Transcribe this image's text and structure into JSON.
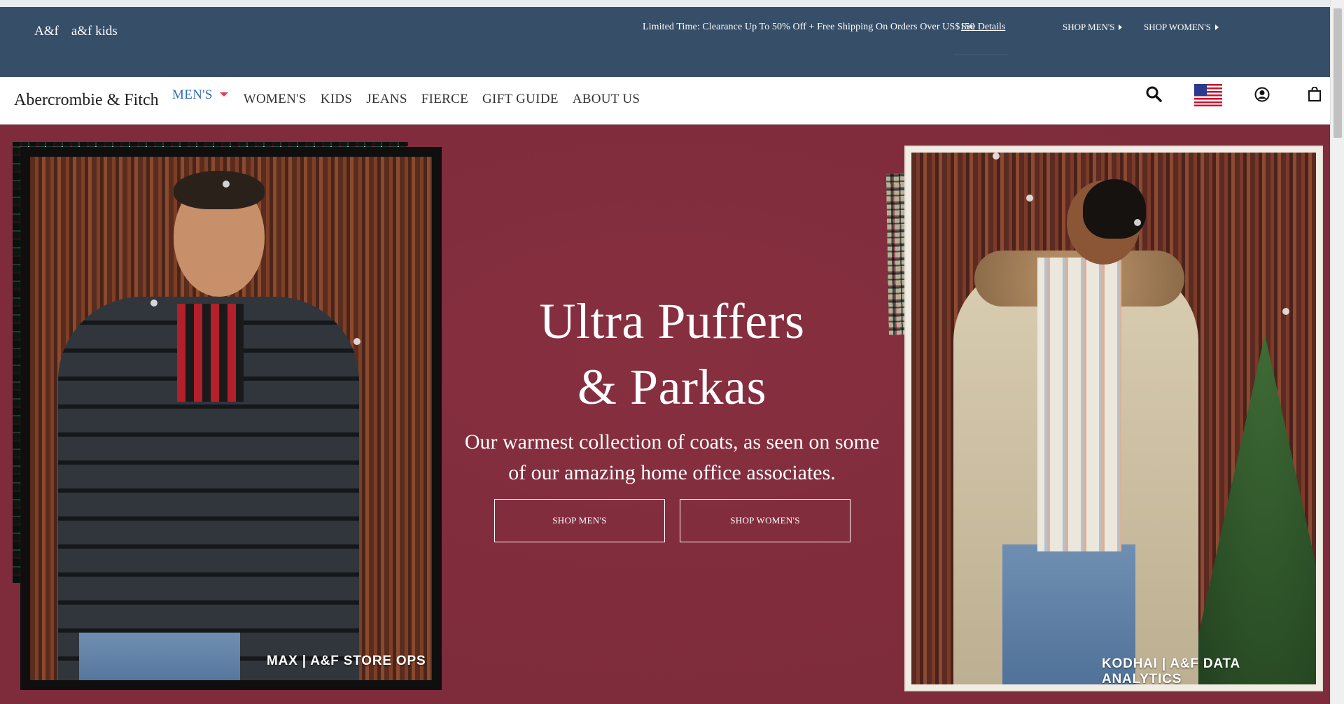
{
  "promo": {
    "brand_af": "A&f",
    "brand_kids": "a&f kids",
    "message": "Limited Time: Clearance Up To 50% Off + Free Shipping On Orders Over US$150",
    "details_link": "See Details",
    "shop_mens": "SHOP MEN'S",
    "shop_womens": "SHOP WOMEN'S",
    "background_color": "#364e68"
  },
  "nav": {
    "logo": "Abercrombie & Fitch",
    "items": [
      {
        "label": "MEN'S",
        "active": true
      },
      {
        "label": "WOMEN'S"
      },
      {
        "label": "KIDS"
      },
      {
        "label": "JEANS"
      },
      {
        "label": "FIERCE"
      },
      {
        "label": "GIFT GUIDE"
      },
      {
        "label": "ABOUT US"
      }
    ],
    "icons": [
      "search-icon",
      "us-flag-icon",
      "account-icon",
      "shopping-bag-icon"
    ],
    "active_color": "#2f6fb3",
    "caret_color": "#e23a4e"
  },
  "hero": {
    "title_line1": "Ultra Puffers",
    "title_line2": "& Parkas",
    "subtitle": "Our warmest collection of coats, as seen on some of our amazing home office associates.",
    "button_mens": "SHOP MEN'S",
    "button_womens": "SHOP WOMEN'S",
    "caption_left": "MAX | A&F STORE OPS",
    "caption_right": "KODHAI | A&F DATA ANALYTICS",
    "background_color": "#7e2b3b"
  }
}
